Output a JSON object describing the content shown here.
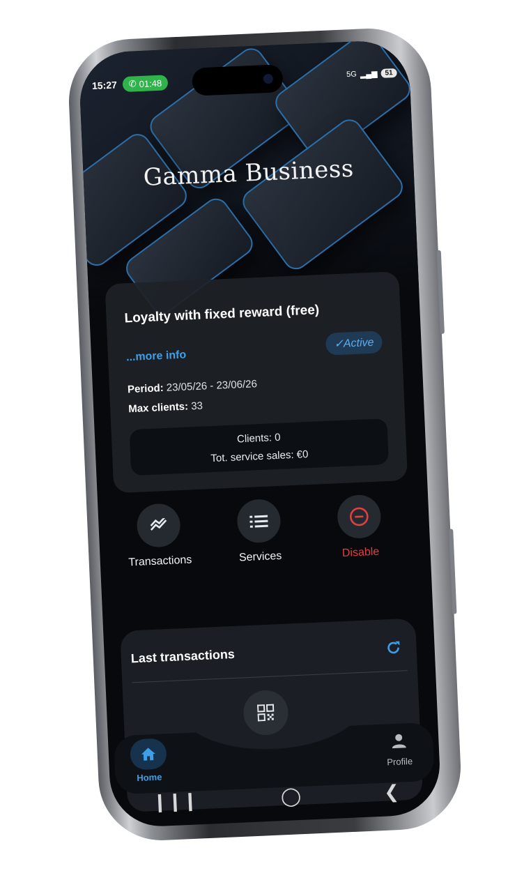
{
  "status_bar": {
    "time": "15:27",
    "call_duration": "01:48",
    "network": "5G",
    "battery": "51"
  },
  "brand": {
    "name": "Gamma Business"
  },
  "campaign": {
    "title": "Loyalty with fixed reward (free)",
    "more_info": "...more info",
    "status": "Active",
    "period_label": "Period:",
    "period_value": "23/05/26 - 23/06/26",
    "max_clients_label": "Max clients:",
    "max_clients_value": "33",
    "clients_line": "Clients:  0",
    "sales_line": "Tot. service sales:  €0"
  },
  "actions": [
    {
      "label": "Transactions",
      "icon": "chart-trend-icon"
    },
    {
      "label": "Services",
      "icon": "list-icon"
    },
    {
      "label": "Disable",
      "icon": "minus-circle-icon",
      "color": "#e0403f"
    }
  ],
  "last_transactions": {
    "title": "Last transactions",
    "refresh_icon": "refresh-icon"
  },
  "bottom_nav": {
    "home": "Home",
    "profile": "Profile",
    "scan_icon": "qr-code-icon"
  },
  "colors": {
    "accent": "#3e9fe8",
    "danger": "#e0403f",
    "call_green": "#2fb34a",
    "background": "#07090d"
  }
}
